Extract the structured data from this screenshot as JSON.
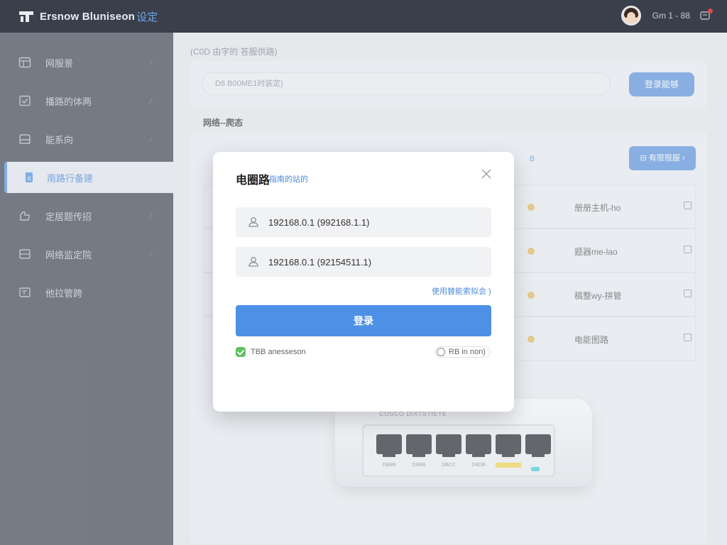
{
  "app": {
    "title": "Ersnow Bluniseon",
    "title_accent": "设定"
  },
  "user": {
    "name": "Gm 1 - 88"
  },
  "sidebar": {
    "items": [
      {
        "label": "网服景",
        "icon": "panel-icon"
      },
      {
        "label": "播路的体两",
        "icon": "shield-icon"
      },
      {
        "label": "能系向",
        "icon": "router-icon"
      },
      {
        "label": "南路行备建",
        "icon": "device-icon",
        "active": true
      },
      {
        "label": "定居题传招",
        "icon": "hand-icon"
      },
      {
        "label": "网络监定院",
        "icon": "monitor-icon"
      },
      {
        "label": "他拉管跨",
        "icon": "window-icon"
      }
    ]
  },
  "main": {
    "breadcrumb": "(C0D 由字的 答服供路)",
    "search_placeholder": "D8 B00ME1时装定)",
    "query_button": "登录能够",
    "section_title": "网络--爬态",
    "link_fragment": "B",
    "filter_button": "有限限服",
    "devices": [
      {
        "name": "册册主机-ho"
      },
      {
        "name": "题器me-lao"
      },
      {
        "name": "稿整wy-拼管"
      },
      {
        "name": "电能图路"
      }
    ]
  },
  "router": {
    "label": "COSCO DIXTSTIETE",
    "ports": [
      "DBBB",
      "DBBB",
      "DBCC",
      "DBDB",
      "BBBB",
      ""
    ]
  },
  "modal": {
    "title": "电圈路",
    "subtitle": "指南的站的",
    "field1_value": "192168.0.1 (992168.1.1)",
    "field2_value": "192168.0.1 (92154511.1)",
    "forgot_link": "使用替能索拟会 )",
    "login_button": "登录",
    "remember_label": "TBB anesseson",
    "help_label": "RB in non)"
  },
  "colors": {
    "accent": "#4d90e6",
    "sidebar_bg": "#3b404d",
    "topbar_bg": "#3a3f4c",
    "success": "#5ec05e",
    "port_led": "#3ed1d6"
  }
}
